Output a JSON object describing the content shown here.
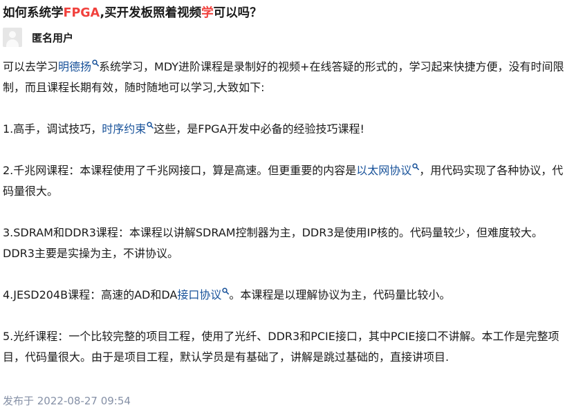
{
  "question": {
    "title_parts": [
      {
        "text": "如何系统学",
        "hl": false
      },
      {
        "text": "FPGA",
        "hl": true
      },
      {
        "text": ",买开发板照着视频",
        "hl": false
      },
      {
        "text": "学",
        "hl": true
      },
      {
        "text": "可以吗？",
        "hl": false
      }
    ]
  },
  "answer": {
    "author": {
      "name": "匿名用户",
      "avatar_icon": "anonymous-avatar-icon"
    },
    "paragraphs": [
      [
        {
          "t": "可以去学习"
        },
        {
          "t": "明德扬",
          "link": true
        },
        {
          "t": "系统学习，MDY进阶课程是录制好的视频+在线答疑的形式的，学习起来快捷方便，没有时间限制，而且课程长期有效，随时随地可以学习,大致如下:"
        }
      ],
      [
        {
          "t": "1.高手，调试技巧，"
        },
        {
          "t": "时序约束",
          "link": true
        },
        {
          "t": "这些，是FPGA开发中必备的经验技巧课程!"
        }
      ],
      [
        {
          "t": "2.千兆网课程：本课程使用了千兆网接口，算是高速。但更重要的内容是"
        },
        {
          "t": "以太网协议",
          "link": true
        },
        {
          "t": "，用代码实现了各种协议，代码量很大。"
        }
      ],
      [
        {
          "t": "3.SDRAM和DDR3课程：本课程以讲解SDRAM控制器为主，DDR3是使用IP核的。代码量较少，但难度较大。DDR3主要是实操为主，不讲协议。"
        }
      ],
      [
        {
          "t": "4.JESD204B课程：高速的AD和DA"
        },
        {
          "t": "接口协议",
          "link": true
        },
        {
          "t": "。本课程是以理解协议为主，代码量比较小。"
        }
      ],
      [
        {
          "t": "5.光纤课程：一个比较完整的项目工程，使用了光纤、DDR3和PCIE接口，其中PCIE接口不讲解。本工作是完整项目，代码量很大。由于是项目工程，默认学员是有基础了，讲解是跳过基础的，直接讲项目."
        }
      ]
    ],
    "published": "发布于 2022-08-27 09:54"
  },
  "colors": {
    "highlight": "#f1403c",
    "link": "#175199",
    "meta": "#8590a6"
  },
  "icons": {
    "keyword_search": "search-icon"
  }
}
